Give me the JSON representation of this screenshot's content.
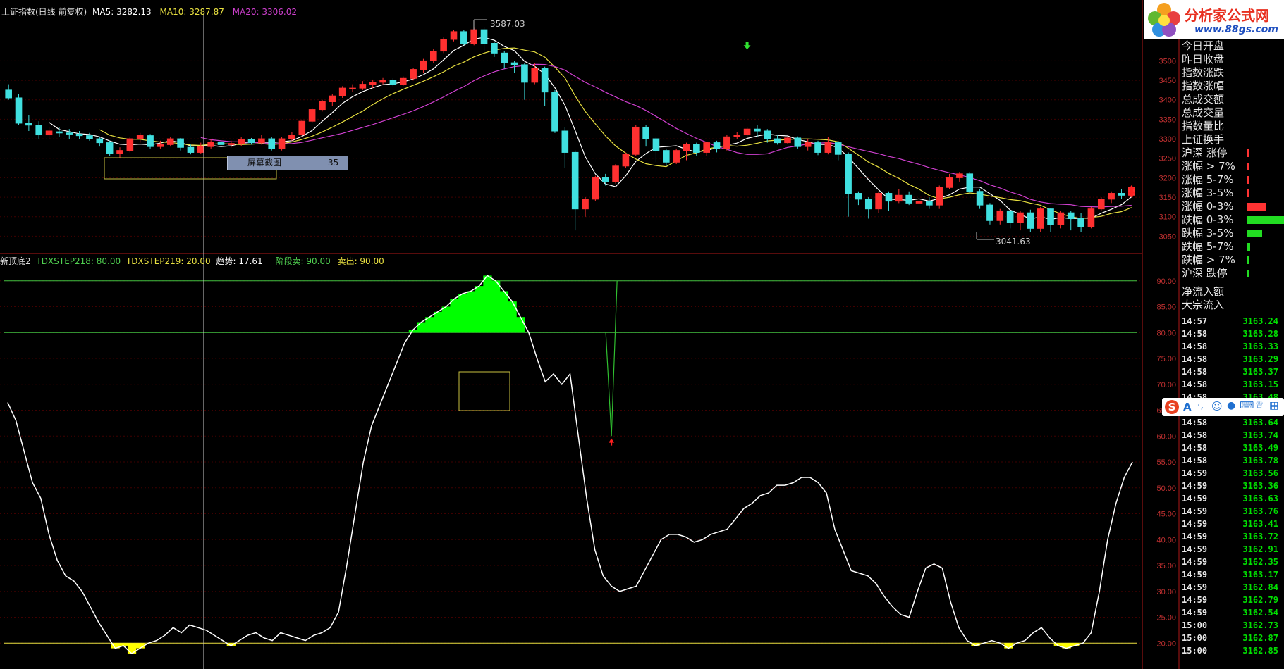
{
  "header": {
    "title": "上证指数(日线 前复权)",
    "ma5": "MA5: 3282.13",
    "ma10": "MA10: 3287.87",
    "ma20": "MA20: 3306.02",
    "indicator_name": "新顶底2",
    "step218": "TDXSTEP218: 80.00",
    "step219": "TDXSTEP219: 20.00",
    "trend": "趋势: 17.61",
    "stage_sell": "阶段卖: 90.00",
    "sell_out": "卖出: 90.00"
  },
  "annotations": {
    "high": "3587.03",
    "low": "3041.63",
    "screenshot_label": "屏幕截图",
    "screenshot_count": "35"
  },
  "logo": {
    "name": "分析家公式网",
    "url": "www.88gs.com"
  },
  "side_stats": [
    {
      "label": "今日开盘"
    },
    {
      "label": "昨日收盘"
    },
    {
      "label": "指数涨跌"
    },
    {
      "label": "指数涨幅"
    },
    {
      "label": "总成交额"
    },
    {
      "label": "总成交量"
    },
    {
      "label": "指数量比"
    },
    {
      "label": "上证换手"
    }
  ],
  "breadth": [
    {
      "label": "沪深 涨停",
      "color": "#ff3333",
      "fill": 0.01
    },
    {
      "label": "涨幅 > 7%",
      "color": "#ff3333",
      "fill": 0.01
    },
    {
      "label": "涨幅 5-7%",
      "color": "#ff3333",
      "fill": 0.01
    },
    {
      "label": "涨幅 3-5%",
      "color": "#ff3333",
      "fill": 0.05
    },
    {
      "label": "涨幅 0-3%",
      "color": "#ff3333",
      "fill": 0.5
    },
    {
      "label": "跌幅 0-3%",
      "color": "#22dd22",
      "fill": 1.0
    },
    {
      "label": "跌幅 3-5%",
      "color": "#22dd22",
      "fill": 0.4
    },
    {
      "label": "跌幅 5-7%",
      "color": "#22dd22",
      "fill": 0.08
    },
    {
      "label": "跌幅 > 7%",
      "color": "#22dd22",
      "fill": 0.01
    },
    {
      "label": "沪深 跌停",
      "color": "#22dd22",
      "fill": 0.01
    }
  ],
  "flow": [
    {
      "label": "净流入额"
    },
    {
      "label": "大宗流入"
    }
  ],
  "ticks": [
    {
      "time": "14:57",
      "price": "3163.24"
    },
    {
      "time": "14:58",
      "price": "3163.28"
    },
    {
      "time": "14:58",
      "price": "3163.33"
    },
    {
      "time": "14:58",
      "price": "3163.29"
    },
    {
      "time": "14:58",
      "price": "3163.37"
    },
    {
      "time": "14:58",
      "price": "3163.15"
    },
    {
      "time": "14:58",
      "price": "3163.48"
    },
    {
      "time": "14:58",
      "price": "3163.48"
    },
    {
      "time": "14:58",
      "price": "3163.64"
    },
    {
      "time": "14:58",
      "price": "3163.74"
    },
    {
      "time": "14:58",
      "price": "3163.49"
    },
    {
      "time": "14:58",
      "price": "3163.78"
    },
    {
      "time": "14:59",
      "price": "3163.56"
    },
    {
      "time": "14:59",
      "price": "3163.36"
    },
    {
      "time": "14:59",
      "price": "3163.63"
    },
    {
      "time": "14:59",
      "price": "3163.76"
    },
    {
      "time": "14:59",
      "price": "3163.41"
    },
    {
      "time": "14:59",
      "price": "3163.72"
    },
    {
      "time": "14:59",
      "price": "3162.91"
    },
    {
      "time": "14:59",
      "price": "3162.35"
    },
    {
      "time": "14:59",
      "price": "3163.17"
    },
    {
      "time": "14:59",
      "price": "3162.84"
    },
    {
      "time": "14:59",
      "price": "3162.79"
    },
    {
      "time": "14:59",
      "price": "3162.54"
    },
    {
      "time": "15:00",
      "price": "3162.73"
    },
    {
      "time": "15:00",
      "price": "3162.87"
    },
    {
      "time": "15:00",
      "price": "3162.85"
    }
  ],
  "toolbar": {
    "icons": [
      "sogou-icon",
      "font-icon",
      "punctuation-icon",
      "emoji-icon",
      "mic-icon",
      "keyboard-icon",
      "clothes-icon",
      "grid-icon"
    ]
  },
  "chart_data": [
    {
      "type": "candlestick",
      "title": "上证指数(日线 前复权)",
      "ylim": [
        3020,
        3620
      ],
      "yticks": [
        3050,
        3100,
        3150,
        3200,
        3250,
        3300,
        3350,
        3400,
        3450,
        3500
      ],
      "candles": [
        [
          3425,
          3405,
          3440,
          3400
        ],
        [
          3405,
          3340,
          3415,
          3335
        ],
        [
          3340,
          3335,
          3360,
          3320
        ],
        [
          3335,
          3310,
          3345,
          3300
        ],
        [
          3310,
          3320,
          3330,
          3300
        ],
        [
          3318,
          3315,
          3330,
          3305
        ],
        [
          3315,
          3312,
          3325,
          3300
        ],
        [
          3312,
          3308,
          3320,
          3300
        ],
        [
          3308,
          3300,
          3315,
          3295
        ],
        [
          3300,
          3290,
          3305,
          3280
        ],
        [
          3290,
          3262,
          3295,
          3255
        ],
        [
          3262,
          3270,
          3278,
          3250
        ],
        [
          3270,
          3300,
          3305,
          3265
        ],
        [
          3300,
          3310,
          3315,
          3290
        ],
        [
          3308,
          3280,
          3312,
          3275
        ],
        [
          3280,
          3285,
          3295,
          3275
        ],
        [
          3285,
          3300,
          3305,
          3280
        ],
        [
          3300,
          3278,
          3302,
          3270
        ],
        [
          3278,
          3265,
          3285,
          3260
        ],
        [
          3265,
          3280,
          3290,
          3262
        ],
        [
          3280,
          3292,
          3298,
          3275
        ],
        [
          3292,
          3285,
          3300,
          3280
        ],
        [
          3285,
          3288,
          3295,
          3278
        ],
        [
          3288,
          3298,
          3305,
          3282
        ],
        [
          3298,
          3290,
          3302,
          3285
        ],
        [
          3290,
          3300,
          3310,
          3285
        ],
        [
          3300,
          3275,
          3305,
          3270
        ],
        [
          3275,
          3300,
          3305,
          3270
        ],
        [
          3300,
          3310,
          3318,
          3295
        ],
        [
          3310,
          3345,
          3350,
          3305
        ],
        [
          3345,
          3375,
          3380,
          3340
        ],
        [
          3375,
          3395,
          3400,
          3370
        ],
        [
          3395,
          3410,
          3415,
          3385
        ],
        [
          3410,
          3430,
          3435,
          3405
        ],
        [
          3430,
          3430,
          3440,
          3420
        ],
        [
          3430,
          3440,
          3448,
          3425
        ],
        [
          3440,
          3445,
          3452,
          3430
        ],
        [
          3445,
          3450,
          3456,
          3440
        ],
        [
          3450,
          3440,
          3455,
          3435
        ],
        [
          3440,
          3455,
          3460,
          3436
        ],
        [
          3455,
          3478,
          3482,
          3450
        ],
        [
          3478,
          3500,
          3505,
          3470
        ],
        [
          3500,
          3525,
          3530,
          3495
        ],
        [
          3525,
          3555,
          3560,
          3520
        ],
        [
          3555,
          3575,
          3580,
          3550
        ],
        [
          3575,
          3545,
          3580,
          3540
        ],
        [
          3545,
          3580,
          3585,
          3540
        ],
        [
          3580,
          3545,
          3587,
          3525
        ],
        [
          3545,
          3520,
          3550,
          3510
        ],
        [
          3520,
          3495,
          3525,
          3480
        ],
        [
          3495,
          3490,
          3500,
          3470
        ],
        [
          3490,
          3445,
          3495,
          3400
        ],
        [
          3445,
          3480,
          3495,
          3440
        ],
        [
          3480,
          3420,
          3485,
          3385
        ],
        [
          3420,
          3320,
          3425,
          3315
        ],
        [
          3320,
          3265,
          3330,
          3225
        ],
        [
          3265,
          3120,
          3270,
          3065
        ],
        [
          3120,
          3145,
          3150,
          3100
        ],
        [
          3145,
          3200,
          3205,
          3140
        ],
        [
          3200,
          3190,
          3210,
          3180
        ],
        [
          3190,
          3230,
          3235,
          3185
        ],
        [
          3230,
          3260,
          3265,
          3225
        ],
        [
          3260,
          3330,
          3335,
          3255
        ],
        [
          3330,
          3300,
          3335,
          3280
        ],
        [
          3300,
          3270,
          3305,
          3240
        ],
        [
          3270,
          3240,
          3275,
          3230
        ],
        [
          3240,
          3270,
          3275,
          3235
        ],
        [
          3270,
          3285,
          3290,
          3245
        ],
        [
          3285,
          3265,
          3290,
          3255
        ],
        [
          3265,
          3290,
          3292,
          3255
        ],
        [
          3290,
          3275,
          3295,
          3265
        ],
        [
          3275,
          3305,
          3310,
          3270
        ],
        [
          3305,
          3310,
          3318,
          3300
        ],
        [
          3310,
          3325,
          3330,
          3305
        ],
        [
          3325,
          3320,
          3335,
          3305
        ],
        [
          3320,
          3300,
          3325,
          3290
        ],
        [
          3300,
          3290,
          3310,
          3285
        ],
        [
          3290,
          3302,
          3305,
          3288
        ],
        [
          3302,
          3280,
          3306,
          3275
        ],
        [
          3280,
          3290,
          3300,
          3270
        ],
        [
          3290,
          3265,
          3295,
          3258
        ],
        [
          3265,
          3290,
          3305,
          3260
        ],
        [
          3290,
          3260,
          3295,
          3245
        ],
        [
          3260,
          3160,
          3265,
          3100
        ],
        [
          3160,
          3145,
          3165,
          3130
        ],
        [
          3145,
          3120,
          3150,
          3095
        ],
        [
          3120,
          3160,
          3165,
          3110
        ],
        [
          3160,
          3140,
          3165,
          3115
        ],
        [
          3140,
          3155,
          3170,
          3135
        ],
        [
          3155,
          3135,
          3165,
          3130
        ],
        [
          3135,
          3140,
          3145,
          3120
        ],
        [
          3140,
          3130,
          3150,
          3120
        ],
        [
          3130,
          3175,
          3180,
          3120
        ],
        [
          3175,
          3200,
          3210,
          3170
        ],
        [
          3200,
          3210,
          3215,
          3190
        ],
        [
          3210,
          3165,
          3215,
          3160
        ],
        [
          3165,
          3130,
          3170,
          3120
        ],
        [
          3130,
          3090,
          3135,
          3080
        ],
        [
          3090,
          3115,
          3120,
          3080
        ],
        [
          3115,
          3085,
          3118,
          3070
        ],
        [
          3085,
          3110,
          3115,
          3065
        ],
        [
          3110,
          3070,
          3118,
          3060
        ],
        [
          3070,
          3120,
          3125,
          3060
        ],
        [
          3120,
          3080,
          3122,
          3060
        ],
        [
          3080,
          3110,
          3115,
          3070
        ],
        [
          3110,
          3095,
          3115,
          3065
        ],
        [
          3095,
          3075,
          3110,
          3060
        ],
        [
          3075,
          3120,
          3125,
          3070
        ],
        [
          3120,
          3145,
          3150,
          3115
        ],
        [
          3145,
          3160,
          3165,
          3135
        ],
        [
          3160,
          3155,
          3170,
          3145
        ],
        [
          3155,
          3175,
          3180,
          3150
        ]
      ]
    },
    {
      "type": "line",
      "title": "新顶底2",
      "ylim": [
        15,
        95
      ],
      "yticks": [
        20,
        25,
        30,
        35,
        40,
        45,
        50,
        55,
        60,
        65,
        70,
        75,
        80,
        85,
        90
      ],
      "reference_lines": [
        80,
        90,
        20
      ],
      "values": [
        66.5,
        63,
        57,
        51,
        48,
        41,
        36,
        33,
        32,
        30,
        27,
        24,
        21.5,
        19,
        19.5,
        18,
        19,
        20,
        20.5,
        21.5,
        23,
        22,
        23.5,
        23,
        22.5,
        21.5,
        20.5,
        19.5,
        20.5,
        21.5,
        22,
        21,
        20.5,
        22,
        21.5,
        21,
        20.5,
        21.5,
        22,
        23,
        26,
        35,
        45,
        55,
        62,
        66,
        70,
        74,
        78,
        80.5,
        82,
        83,
        84,
        85,
        86.5,
        87.5,
        88,
        89,
        91,
        90,
        88,
        86,
        83,
        80,
        75,
        70.5,
        72,
        70,
        72,
        60,
        48,
        38,
        33,
        31,
        30,
        30.5,
        31,
        34,
        37,
        40,
        41,
        41,
        40.5,
        39.5,
        40,
        41,
        41.5,
        42,
        44,
        46,
        47,
        48.5,
        49,
        50.5,
        50.5,
        51,
        52,
        52,
        51,
        49,
        42,
        38,
        34,
        33.5,
        33,
        31.5,
        29,
        27,
        25.5,
        25,
        30,
        34.5,
        35.3,
        34.5,
        28,
        23,
        20.5,
        19.5,
        20,
        20.5,
        20,
        19,
        20,
        20.5,
        22,
        23,
        21,
        19.5,
        19,
        19.5,
        20,
        22,
        30,
        40,
        47,
        52,
        55
      ],
      "buy_marker_index": 73,
      "sell_spike_index": 73
    }
  ]
}
